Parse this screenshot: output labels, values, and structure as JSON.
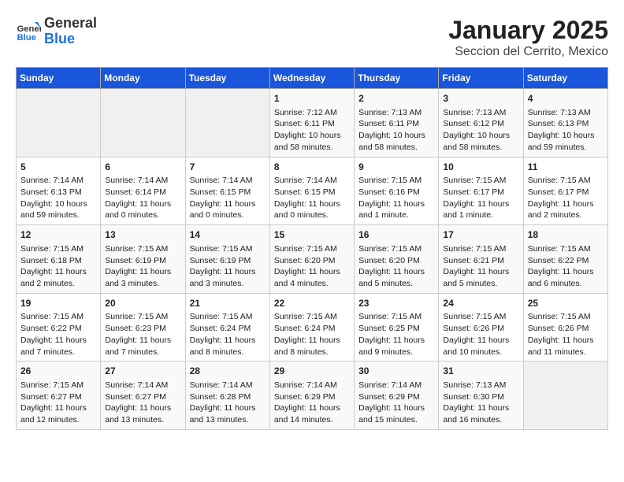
{
  "logo": {
    "general": "General",
    "blue": "Blue"
  },
  "title": "January 2025",
  "subtitle": "Seccion del Cerrito, Mexico",
  "weekdays": [
    "Sunday",
    "Monday",
    "Tuesday",
    "Wednesday",
    "Thursday",
    "Friday",
    "Saturday"
  ],
  "weeks": [
    [
      {
        "day": "",
        "info": ""
      },
      {
        "day": "",
        "info": ""
      },
      {
        "day": "",
        "info": ""
      },
      {
        "day": "1",
        "info": "Sunrise: 7:12 AM\nSunset: 6:11 PM\nDaylight: 10 hours and 58 minutes."
      },
      {
        "day": "2",
        "info": "Sunrise: 7:13 AM\nSunset: 6:11 PM\nDaylight: 10 hours and 58 minutes."
      },
      {
        "day": "3",
        "info": "Sunrise: 7:13 AM\nSunset: 6:12 PM\nDaylight: 10 hours and 58 minutes."
      },
      {
        "day": "4",
        "info": "Sunrise: 7:13 AM\nSunset: 6:13 PM\nDaylight: 10 hours and 59 minutes."
      }
    ],
    [
      {
        "day": "5",
        "info": "Sunrise: 7:14 AM\nSunset: 6:13 PM\nDaylight: 10 hours and 59 minutes."
      },
      {
        "day": "6",
        "info": "Sunrise: 7:14 AM\nSunset: 6:14 PM\nDaylight: 11 hours and 0 minutes."
      },
      {
        "day": "7",
        "info": "Sunrise: 7:14 AM\nSunset: 6:15 PM\nDaylight: 11 hours and 0 minutes."
      },
      {
        "day": "8",
        "info": "Sunrise: 7:14 AM\nSunset: 6:15 PM\nDaylight: 11 hours and 0 minutes."
      },
      {
        "day": "9",
        "info": "Sunrise: 7:15 AM\nSunset: 6:16 PM\nDaylight: 11 hours and 1 minute."
      },
      {
        "day": "10",
        "info": "Sunrise: 7:15 AM\nSunset: 6:17 PM\nDaylight: 11 hours and 1 minute."
      },
      {
        "day": "11",
        "info": "Sunrise: 7:15 AM\nSunset: 6:17 PM\nDaylight: 11 hours and 2 minutes."
      }
    ],
    [
      {
        "day": "12",
        "info": "Sunrise: 7:15 AM\nSunset: 6:18 PM\nDaylight: 11 hours and 2 minutes."
      },
      {
        "day": "13",
        "info": "Sunrise: 7:15 AM\nSunset: 6:19 PM\nDaylight: 11 hours and 3 minutes."
      },
      {
        "day": "14",
        "info": "Sunrise: 7:15 AM\nSunset: 6:19 PM\nDaylight: 11 hours and 3 minutes."
      },
      {
        "day": "15",
        "info": "Sunrise: 7:15 AM\nSunset: 6:20 PM\nDaylight: 11 hours and 4 minutes."
      },
      {
        "day": "16",
        "info": "Sunrise: 7:15 AM\nSunset: 6:20 PM\nDaylight: 11 hours and 5 minutes."
      },
      {
        "day": "17",
        "info": "Sunrise: 7:15 AM\nSunset: 6:21 PM\nDaylight: 11 hours and 5 minutes."
      },
      {
        "day": "18",
        "info": "Sunrise: 7:15 AM\nSunset: 6:22 PM\nDaylight: 11 hours and 6 minutes."
      }
    ],
    [
      {
        "day": "19",
        "info": "Sunrise: 7:15 AM\nSunset: 6:22 PM\nDaylight: 11 hours and 7 minutes."
      },
      {
        "day": "20",
        "info": "Sunrise: 7:15 AM\nSunset: 6:23 PM\nDaylight: 11 hours and 7 minutes."
      },
      {
        "day": "21",
        "info": "Sunrise: 7:15 AM\nSunset: 6:24 PM\nDaylight: 11 hours and 8 minutes."
      },
      {
        "day": "22",
        "info": "Sunrise: 7:15 AM\nSunset: 6:24 PM\nDaylight: 11 hours and 8 minutes."
      },
      {
        "day": "23",
        "info": "Sunrise: 7:15 AM\nSunset: 6:25 PM\nDaylight: 11 hours and 9 minutes."
      },
      {
        "day": "24",
        "info": "Sunrise: 7:15 AM\nSunset: 6:26 PM\nDaylight: 11 hours and 10 minutes."
      },
      {
        "day": "25",
        "info": "Sunrise: 7:15 AM\nSunset: 6:26 PM\nDaylight: 11 hours and 11 minutes."
      }
    ],
    [
      {
        "day": "26",
        "info": "Sunrise: 7:15 AM\nSunset: 6:27 PM\nDaylight: 11 hours and 12 minutes."
      },
      {
        "day": "27",
        "info": "Sunrise: 7:14 AM\nSunset: 6:27 PM\nDaylight: 11 hours and 13 minutes."
      },
      {
        "day": "28",
        "info": "Sunrise: 7:14 AM\nSunset: 6:28 PM\nDaylight: 11 hours and 13 minutes."
      },
      {
        "day": "29",
        "info": "Sunrise: 7:14 AM\nSunset: 6:29 PM\nDaylight: 11 hours and 14 minutes."
      },
      {
        "day": "30",
        "info": "Sunrise: 7:14 AM\nSunset: 6:29 PM\nDaylight: 11 hours and 15 minutes."
      },
      {
        "day": "31",
        "info": "Sunrise: 7:13 AM\nSunset: 6:30 PM\nDaylight: 11 hours and 16 minutes."
      },
      {
        "day": "",
        "info": ""
      }
    ]
  ]
}
